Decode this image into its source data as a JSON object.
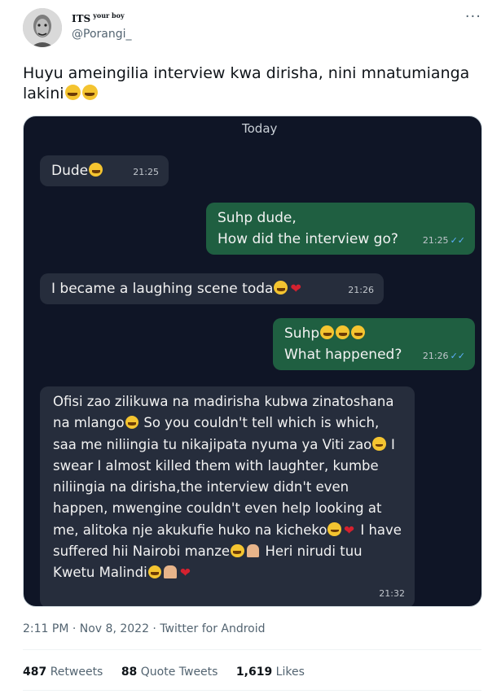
{
  "tweet": {
    "display_name": "ITS",
    "display_name_sup": "your boy",
    "handle": "@Porangi_",
    "more": "···",
    "text": "Huyu ameingilia interview kwa dirisha, nini mnatumianga lakini",
    "text_emojis": "😂😂",
    "meta": "2:11 PM · Nov 8, 2022 · Twitter for Android",
    "retweets_count": "487",
    "retweets_label": "Retweets",
    "quotes_count": "88",
    "quotes_label": "Quote Tweets",
    "likes_count": "1,619",
    "likes_label": "Likes"
  },
  "chat": {
    "day": "Today",
    "messages": [
      {
        "dir": "in",
        "text": "Dude",
        "time": "21:25"
      },
      {
        "dir": "out",
        "line1": "Suhp dude,",
        "line2": "How did the interview go?",
        "time": "21:25"
      },
      {
        "dir": "in",
        "text": "I became a laughing scene toda",
        "time": "21:26"
      },
      {
        "dir": "out",
        "line1": "Suhp",
        "line2": "What happened?",
        "time": "21:26"
      },
      {
        "dir": "in",
        "p1": "Ofisi zao zilikuwa na madirisha kubwa",
        "p2": "zinatoshana na mlango",
        "p3": "So you couldn't tell which is which, saa me niliingia tu nikajipata nyuma ya Viti zao",
        "p4": "I swear I almost killed them with laughter, kumbe niliingia na dirisha,the interview didn't even happen, mwengine couldn't even help looking at me,  alitoka nje akukufie huko na kicheko",
        "p5": "I have suffered hii Nairobi manze",
        "p6": "Heri nirudi tuu Kwetu Malindi",
        "time": "21:32"
      }
    ]
  }
}
